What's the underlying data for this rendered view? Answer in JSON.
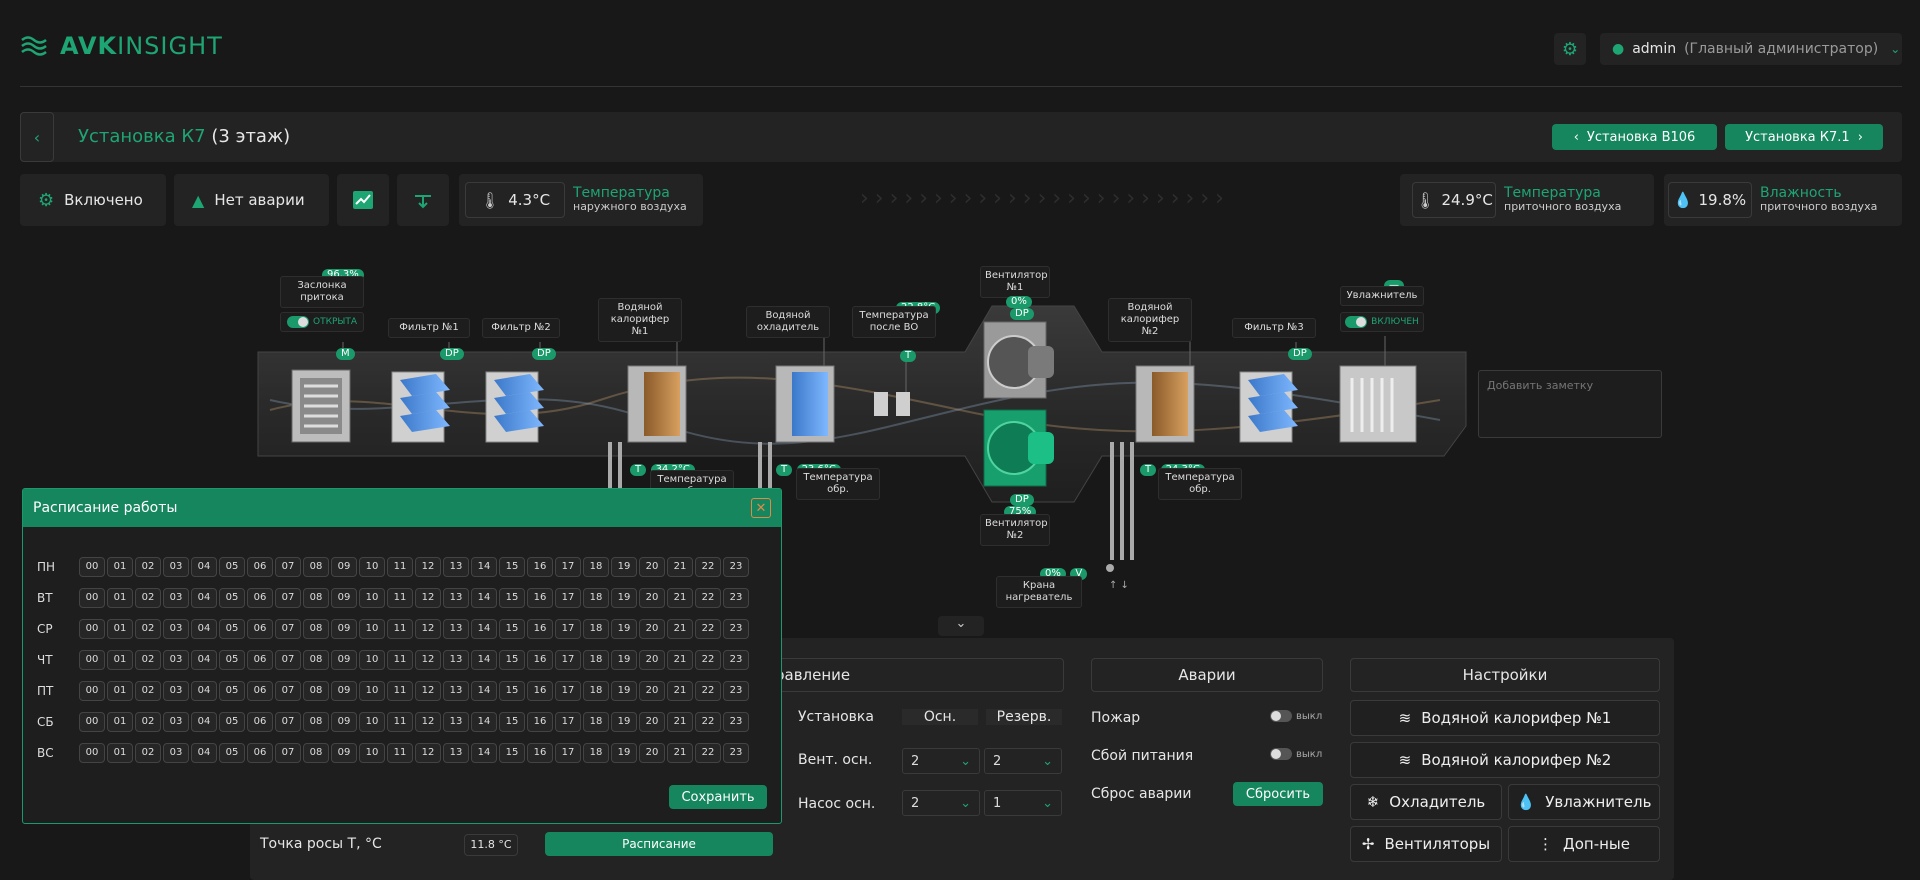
{
  "brand": {
    "name_a": "AVK",
    "name_b": "INSIGHT"
  },
  "user": {
    "name": "admin",
    "role": "(Главный администратор)"
  },
  "unit": {
    "title": "Установка К7",
    "floor": "(3 этаж)",
    "prev": "Установка В106",
    "next": "Установка К7.1"
  },
  "status": {
    "state": "Включено",
    "alarm": "Нет аварии"
  },
  "readings": {
    "outdoor": {
      "value": "4.3°C",
      "title": "Температура",
      "sub": "наружного воздуха"
    },
    "supply_temp": {
      "value": "24.9°C",
      "title": "Температура",
      "sub": "приточного воздуха"
    },
    "supply_hum": {
      "value": "19.8%",
      "title": "Влажность",
      "sub": "приточного воздуха"
    }
  },
  "scheme": {
    "damper": {
      "label": "Заслонка притока",
      "pct": "96.3%",
      "state": "ОТКРЫТА",
      "tag": "M"
    },
    "filter1": {
      "label": "Фильтр №1",
      "tag": "DP"
    },
    "filter2": {
      "label": "Фильтр №2",
      "tag": "DP"
    },
    "heater1": {
      "label": "Водяной калорифер №1",
      "temp": "34.2°C",
      "tag": "T",
      "temp_label": "Температура обр."
    },
    "cooler": {
      "label": "Водяной охладитель",
      "temp": "23.6°C",
      "tag": "T",
      "temp_label": "Температура обр."
    },
    "after_wo": {
      "label": "Температура после ВО",
      "temp": "22.8°C",
      "tag": "T"
    },
    "fan1": {
      "label": "Вентилятор №1",
      "pct": "0%",
      "tag": "DP"
    },
    "fan2": {
      "label": "Вентилятор №2",
      "pct": "75%",
      "tag": "DP"
    },
    "heater2": {
      "label": "Водяной калорифер №2",
      "temp": "24.3°C",
      "tag": "T",
      "temp_label": "Температура обр."
    },
    "filter3": {
      "label": "Фильтр №3",
      "tag": "DP"
    },
    "humidifier": {
      "label": "Увлажнитель",
      "pct": "—",
      "state": "ВКЛЮЧЕН"
    },
    "valve": {
      "label": "Крана нагреватель",
      "pct": "0%",
      "tag": "V"
    },
    "note_placeholder": "Добавить заметку"
  },
  "schedule": {
    "title": "Расписание работы",
    "days": [
      "ПН",
      "ВТ",
      "СР",
      "ЧТ",
      "ПТ",
      "СБ",
      "ВС"
    ],
    "hours": [
      "00",
      "01",
      "02",
      "03",
      "04",
      "05",
      "06",
      "07",
      "08",
      "09",
      "10",
      "11",
      "12",
      "13",
      "14",
      "15",
      "16",
      "17",
      "18",
      "19",
      "20",
      "21",
      "22",
      "23"
    ],
    "save": "Сохранить"
  },
  "control": {
    "tab_label": "равление",
    "unit_label": "Установка",
    "col_main": "Осн.",
    "col_reserve": "Резерв.",
    "fan_label": "Вент. осн.",
    "fan_main": "2",
    "fan_reserve": "2",
    "pump_label": "Насос осн.",
    "pump_main": "2",
    "pump_reserve": "1",
    "dew_label": "Точка росы Т, °С",
    "dew_value": "11.8 °С",
    "schedule_btn": "Расписание"
  },
  "alarms": {
    "title": "Аварии",
    "fire": "Пожар",
    "fire_state": "выкл",
    "power": "Сбой питания",
    "power_state": "выкл",
    "reset_label": "Сброс аварии",
    "reset_btn": "Сбросить"
  },
  "settings": {
    "title": "Настройки",
    "heater1": "Водяной калорифер №1",
    "heater2": "Водяной калорифер №2",
    "cooler": "Охладитель",
    "humidifier": "Увлажнитель",
    "fans": "Вентиляторы",
    "extra": "Доп-ные"
  },
  "colors": {
    "accent": "#1ea574",
    "bg": "#181818",
    "panel": "#232323"
  }
}
